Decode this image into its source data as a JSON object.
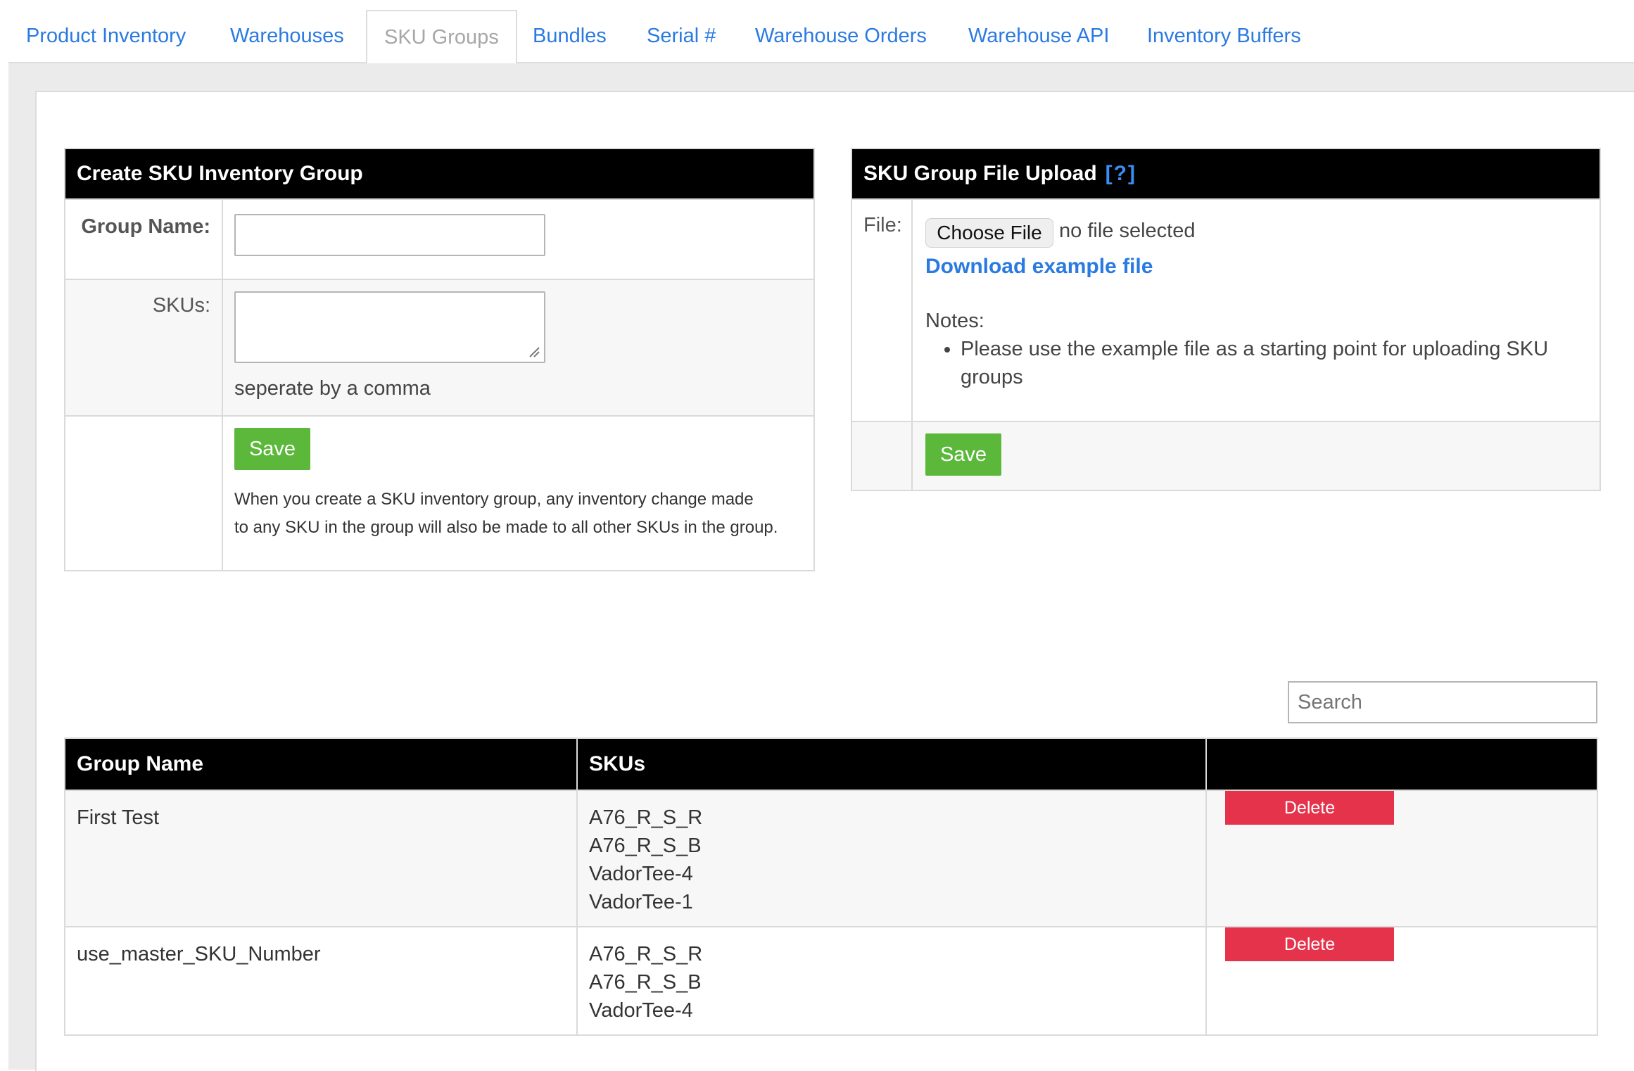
{
  "tabs": [
    {
      "label": "Product Inventory",
      "active": false
    },
    {
      "label": "Warehouses",
      "active": false
    },
    {
      "label": "SKU Groups",
      "active": true
    },
    {
      "label": "Bundles",
      "active": false
    },
    {
      "label": "Serial #",
      "active": false
    },
    {
      "label": "Warehouse Orders",
      "active": false
    },
    {
      "label": "Warehouse API",
      "active": false
    },
    {
      "label": "Inventory Buffers",
      "active": false
    }
  ],
  "create_form": {
    "title": "Create SKU Inventory Group",
    "group_name_label": "Group Name:",
    "group_name_value": "",
    "skus_label": "SKUs:",
    "skus_value": "",
    "skus_hint": "seperate by a comma",
    "save_label": "Save",
    "note_line1": "When you create a SKU inventory group, any inventory change made",
    "note_line2": "to any SKU in the group will also be made to all other SKUs in the group."
  },
  "upload_form": {
    "title": "SKU Group File Upload",
    "help_link": "[?]",
    "file_label": "File:",
    "choose_file_label": "Choose File",
    "no_file_text": "no file selected",
    "download_link": "Download example file",
    "notes_label": "Notes:",
    "note_line1": "Please use the example file as a starting point for uploading SKU",
    "note_line2": "groups",
    "save_label": "Save"
  },
  "search": {
    "placeholder": "Search"
  },
  "groups_table": {
    "headers": [
      "Group Name",
      "SKUs",
      ""
    ],
    "rows": [
      {
        "name": "First Test",
        "skus": [
          "A76_R_S_R",
          "A76_R_S_B",
          "VadorTee-4",
          "VadorTee-1"
        ],
        "action": "Delete"
      },
      {
        "name": "use_master_SKU_Number",
        "skus": [
          "A76_R_S_R",
          "A76_R_S_B",
          "VadorTee-4"
        ],
        "action": "Delete"
      }
    ]
  },
  "colors": {
    "link_blue": "#2a7ae2",
    "save_green": "#5bb83a",
    "delete_red": "#e5334b",
    "header_black": "#000000"
  }
}
